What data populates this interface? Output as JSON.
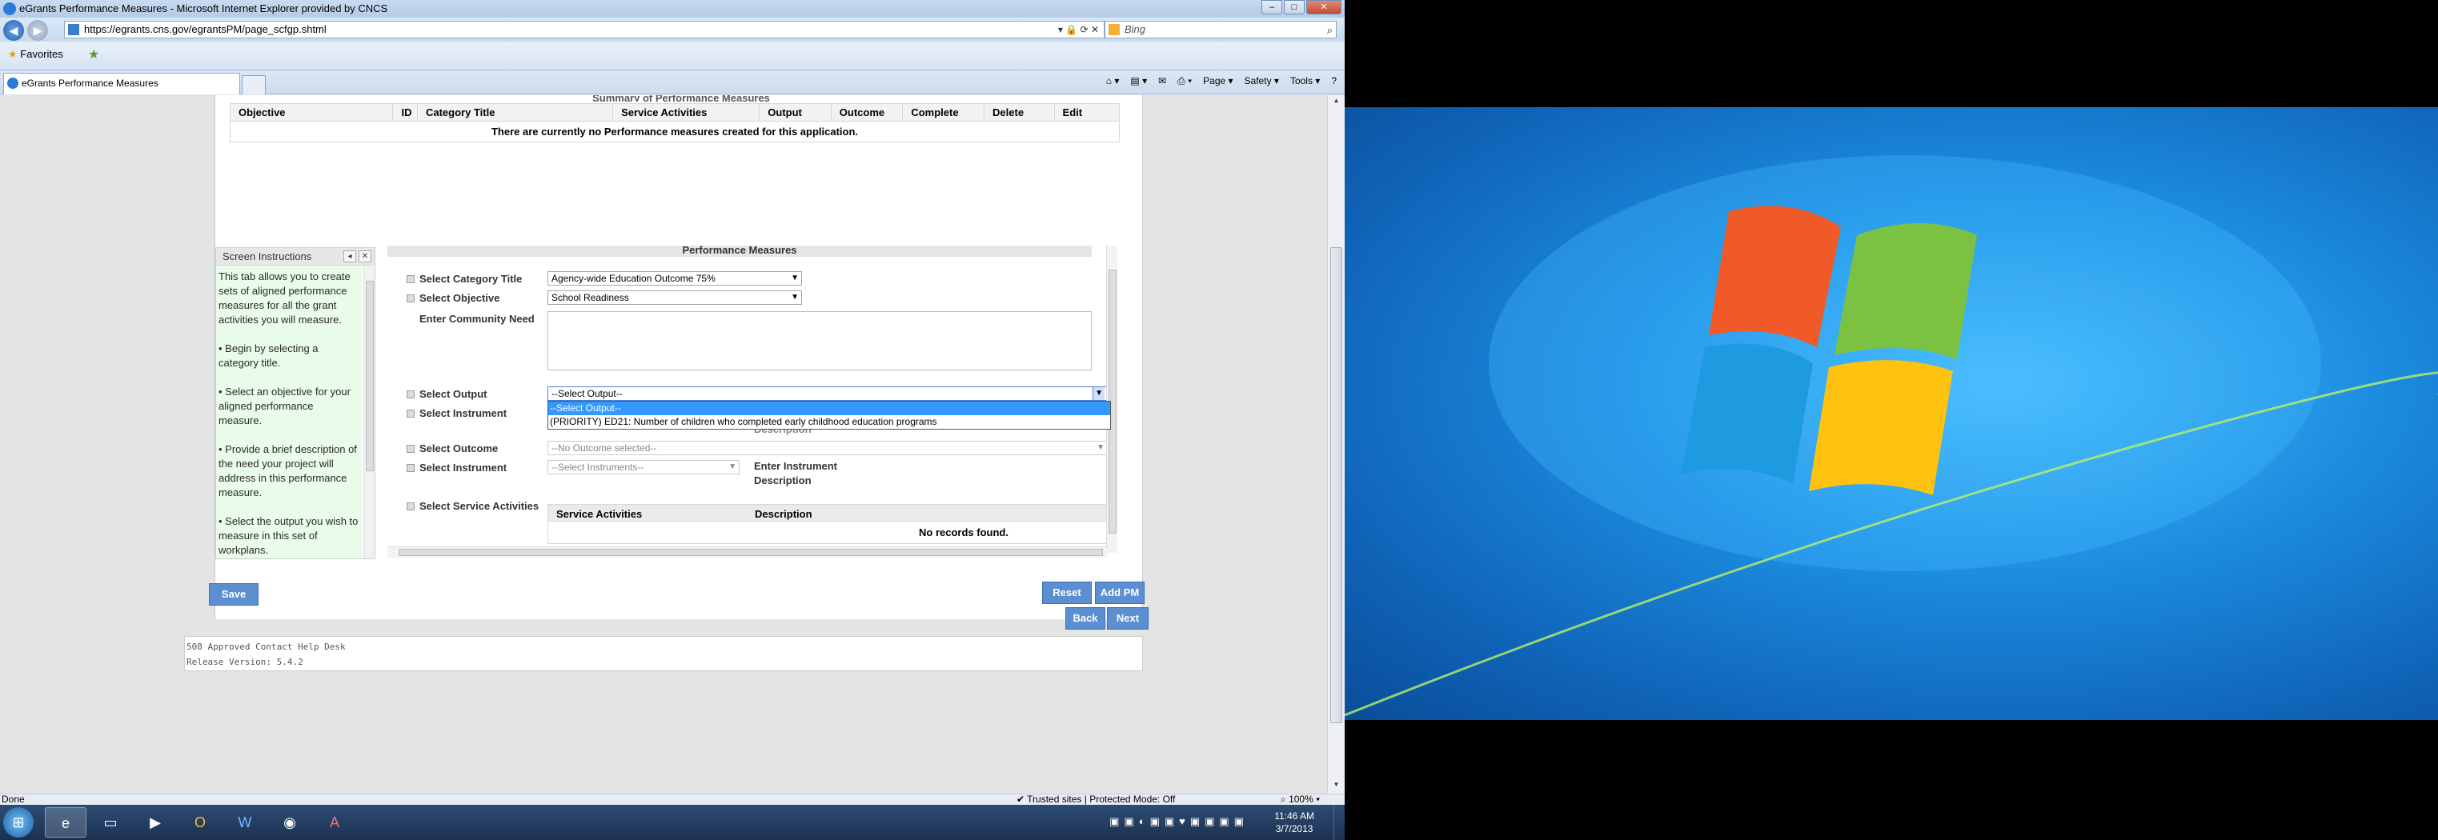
{
  "browser": {
    "window_title": "eGrants Performance Measures - Microsoft Internet Explorer provided by CNCS",
    "address": "https://egrants.cns.gov/egrantsPM/page_scfgp.shtml",
    "search_placeholder": "Bing",
    "favorites_label": "Favorites",
    "tab_label": "eGrants Performance Measures",
    "cmd_page": "Page ▾",
    "cmd_safety": "Safety ▾",
    "cmd_tools": "Tools ▾",
    "cmd_help": "?"
  },
  "summary": {
    "title": "Summary of Performance Measures",
    "columns": [
      "Objective",
      "ID",
      "Category Title",
      "Service Activities",
      "Output",
      "Outcome",
      "Complete",
      "Delete",
      "Edit"
    ],
    "empty_message": "There are currently no Performance measures created for this application."
  },
  "instructions": {
    "title": "Screen Instructions",
    "paragraphs": [
      "This tab allows you to create sets of aligned performance measures for all the grant activities you will measure.",
      "• Begin by selecting a category title.",
      "• Select an objective for your aligned performance measure.",
      "• Provide a brief description of the need your project will address in this performance measure.",
      "• Select the output you wish to measure in this set of workplans."
    ]
  },
  "pm": {
    "title": "Performance Measures",
    "category_label": "Select Category Title",
    "category_value": "Agency-wide Education Outcome 75%",
    "objective_label": "Select Objective",
    "objective_value": "School Readiness",
    "need_label": "Enter Community Need",
    "output_label": "Select Output",
    "output_value": "--Select Output--",
    "output_options": [
      "--Select Output--",
      "(PRIORITY) ED21: Number of children who completed early childhood education programs"
    ],
    "instrument_label": "Select Instrument",
    "hidden_desc_label": "Description",
    "outcome_label": "Select Outcome",
    "outcome_value": "--No Outcome selected--",
    "instrument2_label": "Select Instrument",
    "instrument2_value": "--Select Instruments--",
    "enter_instrument_desc": "Enter Instrument",
    "enter_instrument_desc2": "Description",
    "service_label": "Select Service Activities",
    "sa_col1": "Service Activities",
    "sa_col2": "Description",
    "sa_empty": "No records found."
  },
  "buttons": {
    "save": "Save",
    "reset": "Reset",
    "add_pm": "Add PM",
    "back": "Back",
    "next": "Next"
  },
  "footer": {
    "help": "508 Approved Contact Help Desk",
    "release": "Release Version: 5.4.2"
  },
  "statusbar": {
    "done": "Done",
    "zone": "Trusted sites | Protected Mode: Off",
    "zoom": "100%"
  },
  "taskbar": {
    "time": "11:46 AM",
    "date": "3/7/2013"
  },
  "colors": {
    "button_blue": "#5b8fd1",
    "instructions_bg": "#e9fbe9",
    "selected_option": "#3399ff"
  }
}
